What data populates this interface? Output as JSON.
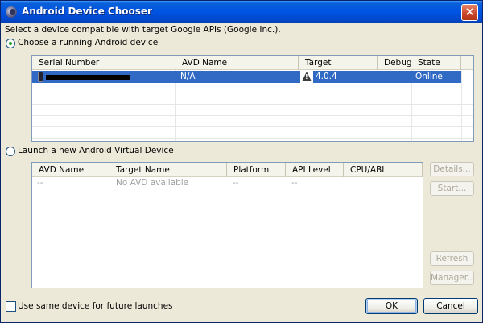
{
  "window": {
    "title": "Android Device Chooser"
  },
  "prompt": "Select a device compatible with target Google APIs (Google Inc.).",
  "running": {
    "radio_label": "Choose a running Android device",
    "columns": [
      "Serial Number",
      "AVD Name",
      "Target",
      "Debug",
      "State"
    ],
    "rows": [
      {
        "serial": "",
        "avd_name": "N/A",
        "target": "4.0.4",
        "debug": "",
        "state": "Online"
      }
    ]
  },
  "avd": {
    "radio_label": "Launch a new Android Virtual Device",
    "columns": [
      "AVD Name",
      "Target Name",
      "Platform",
      "API Level",
      "CPU/ABI"
    ],
    "rows": [
      {
        "avd_name": "--",
        "target_name": "No AVD available",
        "platform": "--",
        "api_level": "--",
        "cpu_abi": ""
      }
    ],
    "buttons": {
      "details": "Details...",
      "start": "Start...",
      "refresh": "Refresh",
      "manager": "Manager..."
    }
  },
  "footer": {
    "checkbox_label": "Use same device for future launches",
    "ok": "OK",
    "cancel": "Cancel"
  }
}
